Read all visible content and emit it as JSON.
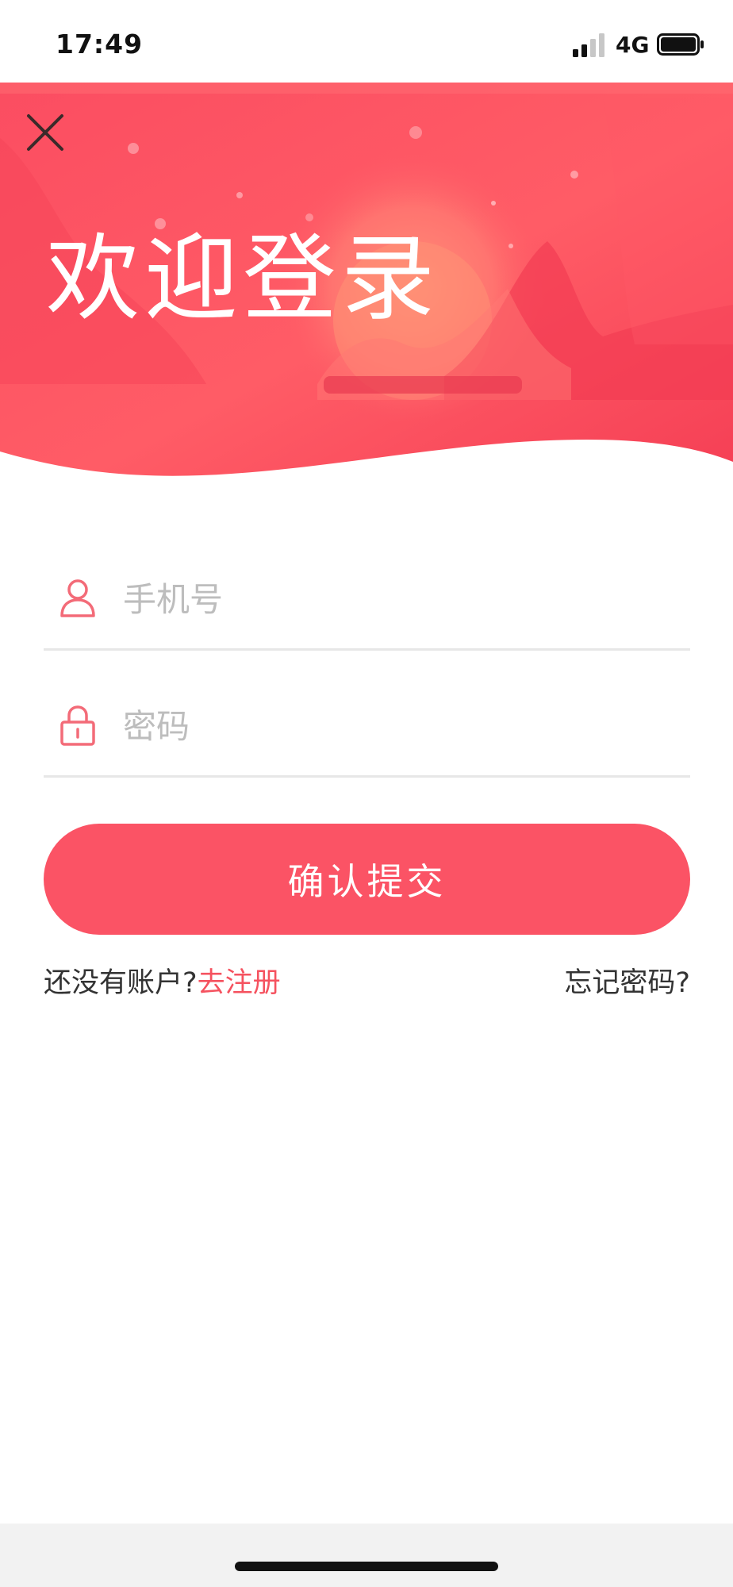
{
  "status_bar": {
    "time": "17:49",
    "network": "4G"
  },
  "banner": {
    "title": "欢迎登录"
  },
  "form": {
    "phone": {
      "placeholder": "手机号",
      "value": ""
    },
    "password": {
      "placeholder": "密码",
      "value": ""
    },
    "submit_label": "确认提交"
  },
  "links": {
    "no_account_text": "还没有账户?",
    "register_label": "去注册",
    "forgot_label": "忘记密码?"
  },
  "colors": {
    "accent": "#fb5365",
    "link": "#f5525f",
    "banner_light": "#ff6d6f",
    "banner_dark": "#f23c52"
  },
  "icons": {
    "close": "close-icon",
    "user": "user-icon",
    "lock": "lock-icon"
  }
}
